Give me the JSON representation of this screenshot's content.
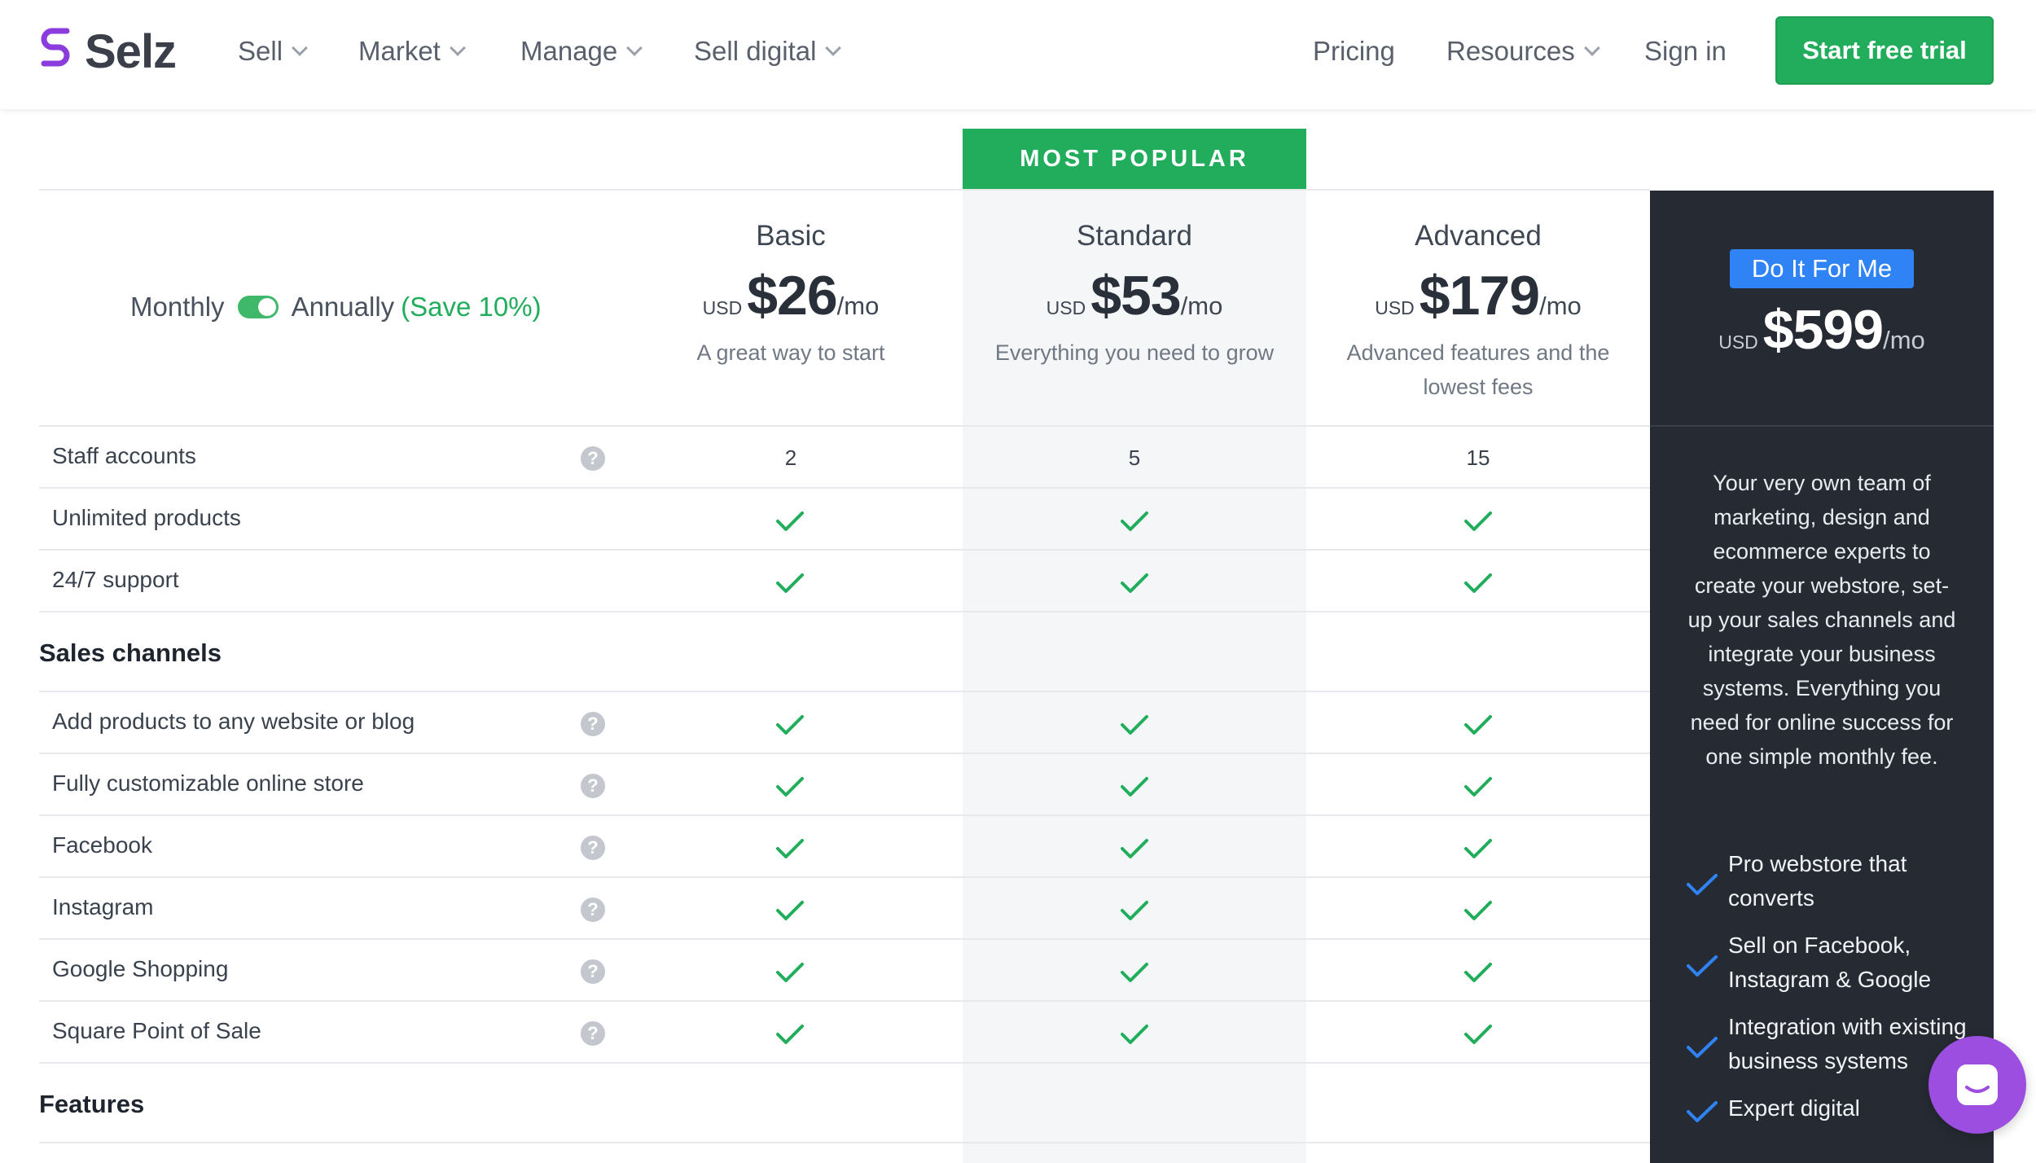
{
  "brand": {
    "name": "Selz",
    "accent": "#22ad5c",
    "logo_color": "#8a3ddc"
  },
  "nav": {
    "left": [
      {
        "label": "Sell",
        "has_dropdown": true
      },
      {
        "label": "Market",
        "has_dropdown": true
      },
      {
        "label": "Manage",
        "has_dropdown": true
      },
      {
        "label": "Sell digital",
        "has_dropdown": true
      }
    ],
    "right": [
      {
        "label": "Pricing",
        "has_dropdown": false
      },
      {
        "label": "Resources",
        "has_dropdown": true
      },
      {
        "label": "Sign in",
        "has_dropdown": false
      }
    ],
    "cta": "Start free trial"
  },
  "billing": {
    "monthly": "Monthly",
    "annually": "Annually",
    "save": "(Save 10%)",
    "toggle_on": true
  },
  "most_popular": "MOST POPULAR",
  "plans": [
    {
      "name": "Basic",
      "currency": "USD",
      "price": "$26",
      "period": "/mo",
      "tagline": "A great way to start"
    },
    {
      "name": "Standard",
      "currency": "USD",
      "price": "$53",
      "period": "/mo",
      "tagline": "Everything you need to grow"
    },
    {
      "name": "Advanced",
      "currency": "USD",
      "price": "$179",
      "period": "/mo",
      "tagline": "Advanced features and the lowest fees"
    }
  ],
  "difm": {
    "button": "Do It For Me",
    "currency": "USD",
    "price": "$599",
    "period": "/mo",
    "description": "Your very own team of marketing, design and ecommerce experts to create your webstore, set-up your sales channels and integrate your business systems. Everything you need for online success for one simple monthly fee.",
    "features": [
      "Pro webstore that converts",
      "Sell on Facebook, Instagram & Google",
      "Integration with existing business systems",
      "Expert digital"
    ]
  },
  "rows_top": [
    {
      "label": "Staff accounts",
      "help": true,
      "values": [
        "2",
        "5",
        "15"
      ]
    },
    {
      "label": "Unlimited products",
      "help": false,
      "values": [
        "check",
        "check",
        "check"
      ]
    },
    {
      "label": "24/7 support",
      "help": false,
      "values": [
        "check",
        "check",
        "check"
      ]
    }
  ],
  "section_sales": "Sales channels",
  "rows_sales": [
    {
      "label": "Add products to any website or blog",
      "help": true,
      "values": [
        "check",
        "check",
        "check"
      ]
    },
    {
      "label": "Fully customizable online store",
      "help": true,
      "values": [
        "check",
        "check",
        "check"
      ]
    },
    {
      "label": "Facebook",
      "help": true,
      "values": [
        "check",
        "check",
        "check"
      ]
    },
    {
      "label": "Instagram",
      "help": true,
      "values": [
        "check",
        "check",
        "check"
      ]
    },
    {
      "label": "Google Shopping",
      "help": true,
      "values": [
        "check",
        "check",
        "check"
      ]
    },
    {
      "label": "Square Point of Sale",
      "help": true,
      "values": [
        "check",
        "check",
        "check"
      ]
    }
  ],
  "section_features": "Features",
  "icons": {
    "help": "help-icon",
    "check": "check-icon",
    "chat": "chat-icon"
  }
}
